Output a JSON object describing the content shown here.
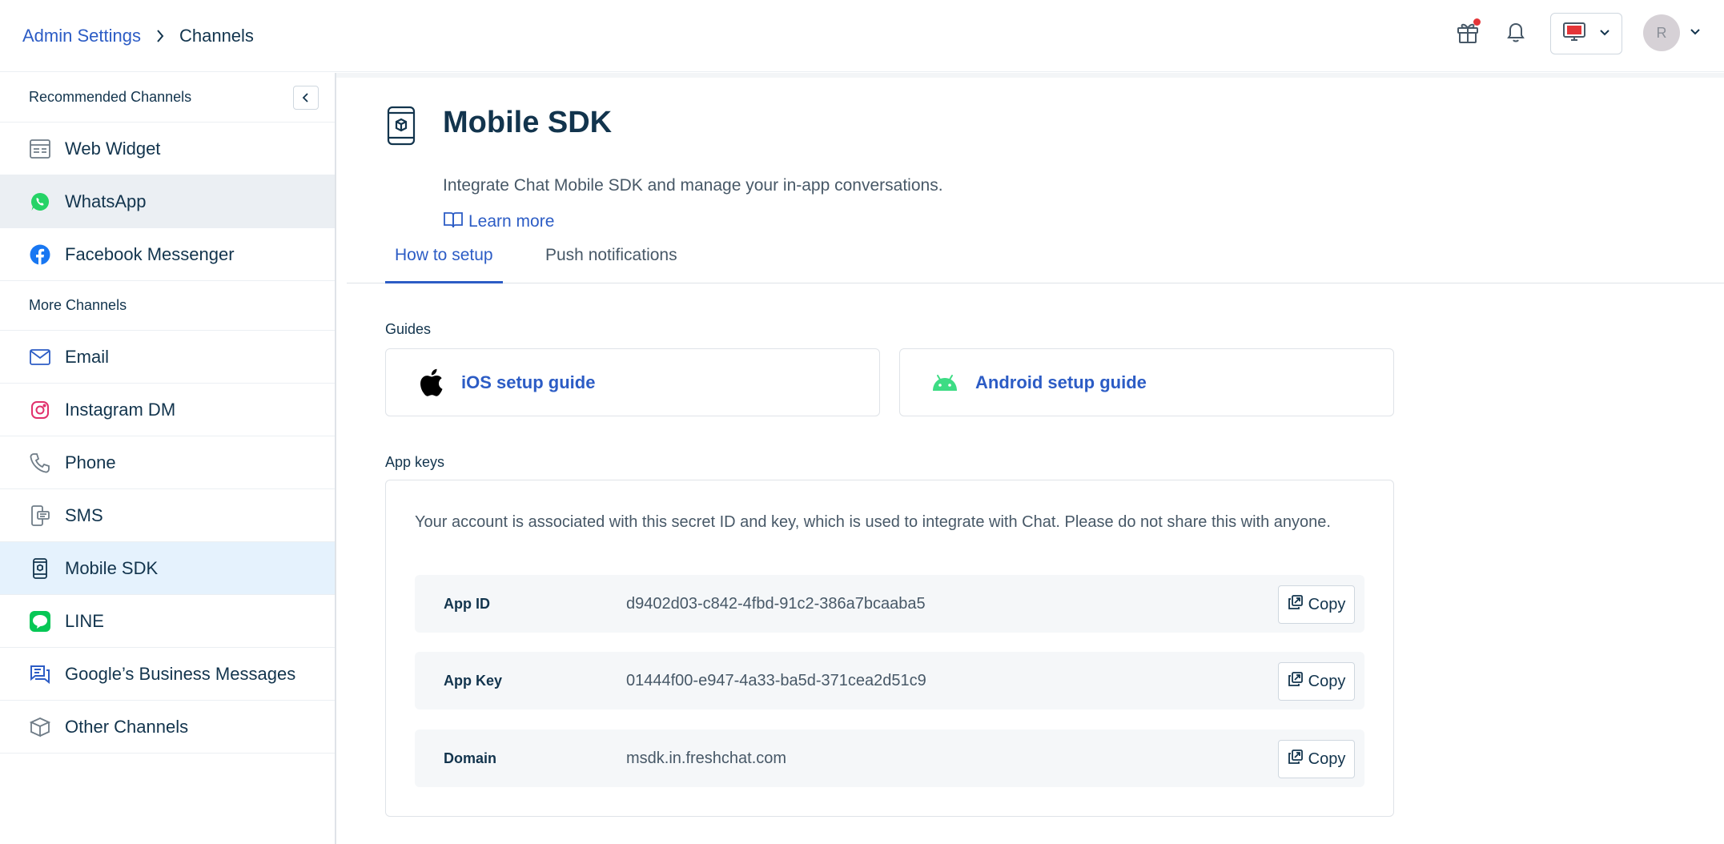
{
  "header": {
    "breadcrumb_parent": "Admin Settings",
    "breadcrumb_current": "Channels",
    "avatar_initial": "R"
  },
  "sidebar": {
    "recommended_title": "Recommended Channels",
    "more_title": "More Channels",
    "recommended": [
      {
        "label": "Web Widget",
        "icon": "web-widget-icon"
      },
      {
        "label": "WhatsApp",
        "icon": "whatsapp-icon"
      },
      {
        "label": "Facebook Messenger",
        "icon": "facebook-icon"
      }
    ],
    "more": [
      {
        "label": "Email",
        "icon": "email-icon"
      },
      {
        "label": "Instagram DM",
        "icon": "instagram-icon"
      },
      {
        "label": "Phone",
        "icon": "phone-icon"
      },
      {
        "label": "SMS",
        "icon": "sms-icon"
      },
      {
        "label": "Mobile SDK",
        "icon": "mobile-sdk-icon"
      },
      {
        "label": "LINE",
        "icon": "line-icon"
      },
      {
        "label": "Google’s Business Messages",
        "icon": "google-business-messages-icon"
      },
      {
        "label": "Other Channels",
        "icon": "other-channels-icon"
      }
    ]
  },
  "main": {
    "title": "Mobile SDK",
    "subtitle": "Integrate Chat Mobile SDK and manage your in-app conversations.",
    "learn_more": "Learn more",
    "tabs": [
      {
        "label": "How to setup",
        "active": true
      },
      {
        "label": "Push notifications",
        "active": false
      }
    ],
    "guides_title": "Guides",
    "guides": [
      {
        "label": "iOS setup guide",
        "icon": "apple-icon"
      },
      {
        "label": "Android setup guide",
        "icon": "android-icon"
      }
    ],
    "app_keys_title": "App keys",
    "app_keys_desc": "Your account is associated with this secret ID and key, which is used to integrate with Chat. Please do not share this with anyone.",
    "keys": [
      {
        "label": "App ID",
        "value": "d9402d03-c842-4fbd-91c2-386a7bcaaba5",
        "copy": "Copy"
      },
      {
        "label": "App Key",
        "value": "01444f00-e947-4a33-ba5d-371cea2d51c9",
        "copy": "Copy"
      },
      {
        "label": "Domain",
        "value": "msdk.in.freshchat.com",
        "copy": "Copy"
      }
    ]
  },
  "colors": {
    "link": "#2c5cc5",
    "text": "#12344d",
    "active_bg": "#e5f2fd",
    "hover_bg": "#ebeff3"
  }
}
